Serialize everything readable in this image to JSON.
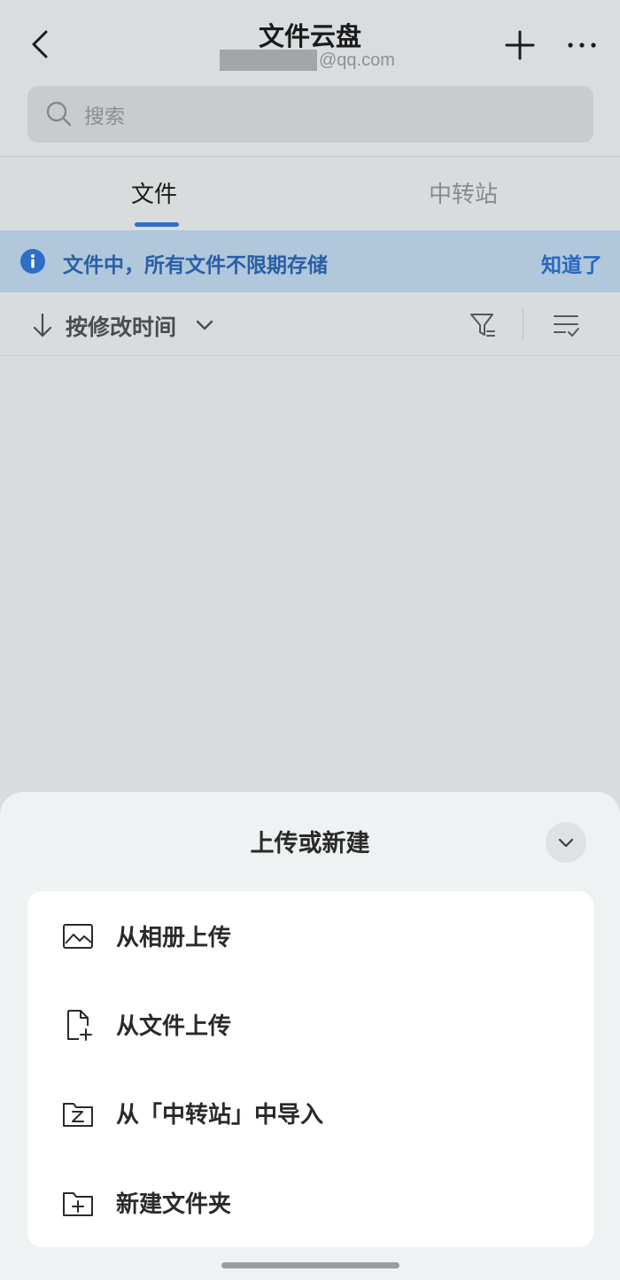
{
  "header": {
    "title": "文件云盘",
    "account_domain": "@qq.com"
  },
  "search": {
    "placeholder": "搜索"
  },
  "tabs": [
    {
      "label": "文件",
      "active": true
    },
    {
      "label": "中转站",
      "active": false
    }
  ],
  "notice": {
    "text": "文件中，所有文件不限期存储",
    "action": "知道了"
  },
  "sort": {
    "label": "按修改时间"
  },
  "sheet": {
    "title": "上传或新建",
    "items": [
      {
        "label": "从相册上传",
        "icon": "image-icon"
      },
      {
        "label": "从文件上传",
        "icon": "file-add-icon"
      },
      {
        "label": "从「中转站」中导入",
        "icon": "transfer-folder-icon"
      },
      {
        "label": "新建文件夹",
        "icon": "folder-add-icon"
      }
    ]
  },
  "colors": {
    "accent": "#2f6ec8",
    "notice_bg": "#b0c7dc",
    "background": "#d9dcdd",
    "sheet_bg": "#eff2f3"
  }
}
